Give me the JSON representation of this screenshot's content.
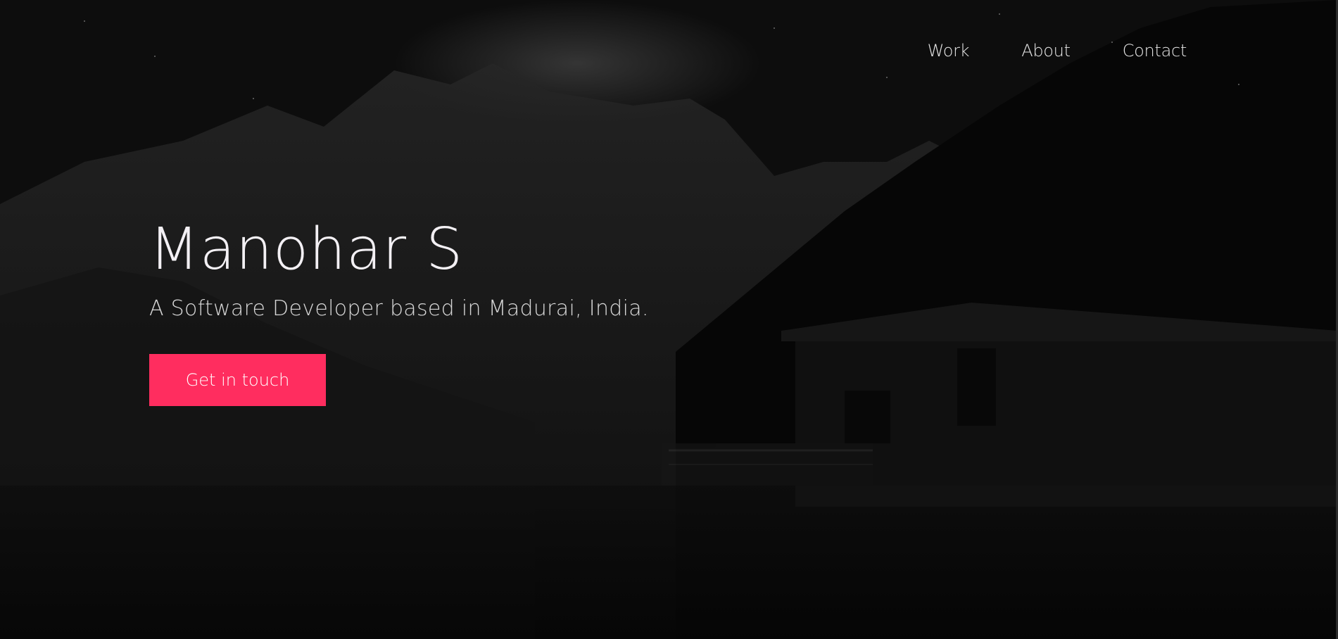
{
  "nav": {
    "items": [
      {
        "label": "Work"
      },
      {
        "label": "About"
      },
      {
        "label": "Contact"
      }
    ]
  },
  "hero": {
    "name": "Manohar S",
    "tagline": "A Software Developer based in Madurai, India.",
    "cta_label": "Get in touch"
  },
  "colors": {
    "accent": "#ff2d5f",
    "background": "#0b0b0b",
    "text_primary": "#f3f0f4",
    "text_secondary": "#d7d7d7"
  },
  "background_image": "dark-mountain-lake-boathouse-photo"
}
